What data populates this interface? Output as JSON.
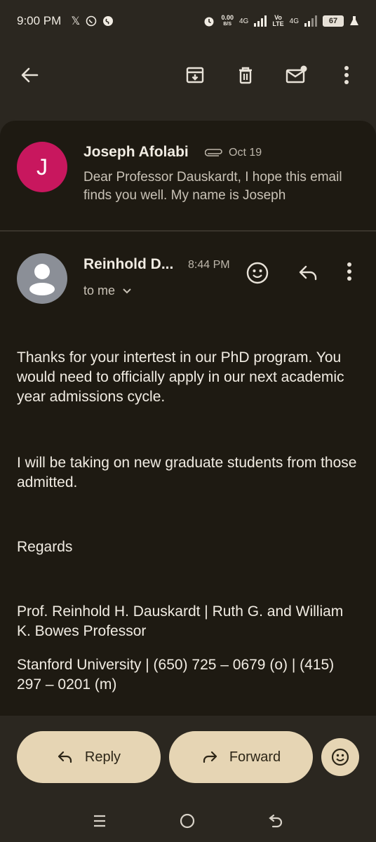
{
  "status_bar": {
    "time": "9:00 PM",
    "net_speed_value": "0.00",
    "net_speed_unit": "B/S",
    "network_1": "4G",
    "volte_top": "Vo",
    "volte_bottom": "LTE",
    "network_2": "4G",
    "battery": "67"
  },
  "toolbar": {
    "icons": [
      "back-arrow-icon",
      "archive-icon",
      "delete-icon",
      "mark-unread-icon",
      "more-vert-icon"
    ]
  },
  "collapsed_message": {
    "avatar_letter": "J",
    "avatar_color": "#c8175e",
    "sender": "Joseph Afolabi",
    "date": "Oct 19",
    "snippet": "Dear Professor Dauskardt, I hope this email finds you well. My name is Joseph"
  },
  "open_message": {
    "sender": "Reinhold D...",
    "time": "8:44 PM",
    "recipient": "to me",
    "paragraphs": [
      "Thanks for your intertest in our PhD program. You would need to officially apply in our next academic year admissions cycle.",
      "I will be taking on new graduate students from those admitted.",
      "Regards",
      "Prof. Reinhold H. Dauskardt | Ruth G. and William K. Bowes Professor",
      "Stanford University | (650) 725 – 0679 (o) | (415) 297 – 0201 (m)"
    ]
  },
  "bottom_actions": {
    "reply_label": "Reply",
    "forward_label": "Forward"
  },
  "colors": {
    "background": "#2b2720",
    "sheet": "#1e1a12",
    "pill": "#e6d5b4"
  }
}
